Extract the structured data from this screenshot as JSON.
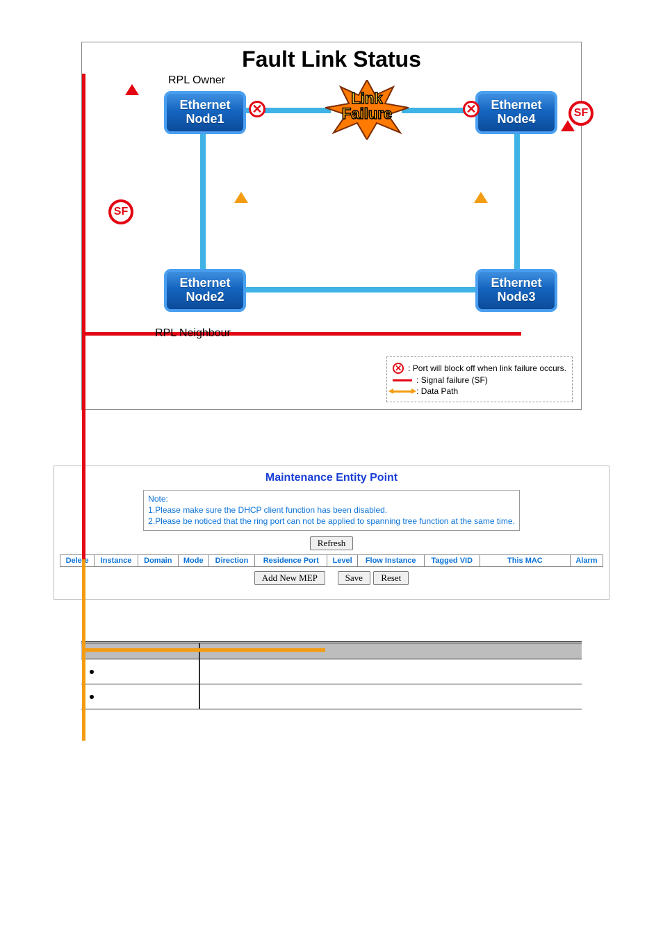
{
  "diagram": {
    "title": "Fault Link Status",
    "rpl_owner": "RPL Owner",
    "rpl_neighbour": "RPL Neighbour",
    "nodes": {
      "n1a": "Ethernet",
      "n1b": "Node1",
      "n2a": "Ethernet",
      "n2b": "Node2",
      "n3a": "Ethernet",
      "n3b": "Node3",
      "n4a": "Ethernet",
      "n4b": "Node4"
    },
    "sf": "SF",
    "link_failure_a": "Link",
    "link_failure_b": "Failure",
    "cross": "✕",
    "legend": {
      "l1": ": Port will block off when link failure occurs.",
      "l2": ": Signal failure (SF)",
      "l3": ": Data Path"
    }
  },
  "mep": {
    "title": "Maintenance Entity Point",
    "note_head": "Note:",
    "note_1": "1.Please make sure the DHCP client function has been disabled.",
    "note_2": "2.Please be noticed that the ring port can not be applied to spanning tree function at the same time.",
    "refresh": "Refresh",
    "cols": {
      "c0": "Delete",
      "c1": "Instance",
      "c2": "Domain",
      "c3": "Mode",
      "c4": "Direction",
      "c5": "Residence Port",
      "c6": "Level",
      "c7": "Flow Instance",
      "c8": "Tagged VID",
      "c9": "This MAC",
      "c10": "Alarm"
    },
    "add": "Add New MEP",
    "save": "Save",
    "reset": "Reset"
  }
}
